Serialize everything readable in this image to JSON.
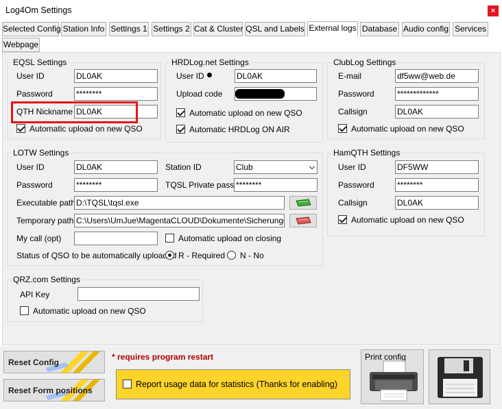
{
  "window": {
    "title": "Log4Om Settings",
    "close_glyph": "×"
  },
  "tabs": [
    {
      "label": "Selected Config"
    },
    {
      "label": "Station Info"
    },
    {
      "label": "Settings 1"
    },
    {
      "label": "Settings 2"
    },
    {
      "label": "Cat & Cluster"
    },
    {
      "label": "QSL and Labels"
    },
    {
      "label": "External logs"
    },
    {
      "label": "Database"
    },
    {
      "label": "Audio config"
    },
    {
      "label": "Services"
    },
    {
      "label": "Webpage"
    }
  ],
  "eqsl": {
    "title": "EQSL Settings",
    "user_id_label": "User ID",
    "user_id": "DL0AK",
    "password_label": "Password",
    "password": "********",
    "qth_label": "QTH Nickname",
    "qth": "DL0AK",
    "auto_label": "Automatic upload on new QSO"
  },
  "hrdlog": {
    "title": "HRDLog.net Settings",
    "user_id_label": "User ID",
    "user_id": "DL0AK",
    "upload_code_label": "Upload code",
    "auto_label": "Automatic upload on new QSO",
    "onair_label": "Automatic HRDLog ON AIR"
  },
  "clublog": {
    "title": "ClubLog Settings",
    "email_label": "E-mail",
    "email": "df5ww@web.de",
    "password_label": "Password",
    "password": "*************",
    "callsign_label": "Callsign",
    "callsign": "DL0AK",
    "auto_label": "Automatic upload on new QSO"
  },
  "lotw": {
    "title": "LOTW Settings",
    "user_id_label": "User ID",
    "user_id": "DL0AK",
    "password_label": "Password",
    "password": "********",
    "station_id_label": "Station ID",
    "station_id": "Club",
    "tqsl_pass_label": "TQSL Private pass",
    "tqsl_pass": "********",
    "exec_label": "Executable path",
    "exec_path": "D:\\TQSL\\tqsl.exe",
    "temp_label": "Temporary path",
    "temp_path": "C:\\Users\\UmJue\\MagentaCLOUD\\Dokumente\\Sicherungen Lc",
    "mycall_label": "My call (opt)",
    "auto_close_label": "Automatic upload on closing",
    "status_label": "Status of QSO to be automatically uploaded",
    "required_label": "R - Required",
    "no_label": "N - No"
  },
  "hamqth": {
    "title": "HamQTH Settings",
    "user_id_label": "User ID",
    "user_id": "DF5WW",
    "password_label": "Password",
    "password": "********",
    "callsign_label": "Callsign",
    "callsign": "DL0AK",
    "auto_label": "Automatic upload on new QSO"
  },
  "qrz": {
    "title": "QRZ.com Settings",
    "api_label": "API Key",
    "auto_label": "Automatic upload on new QSO"
  },
  "bottom": {
    "reset_config": "Reset Config",
    "reset_form": "Reset Form positions",
    "restart_note": "* requires program restart",
    "stats_label": "Report usage data for statistics (Thanks for enabling)",
    "print_config": "Print config"
  },
  "colors": {
    "accent_red": "#e3161c",
    "highlight_yellow": "#ffd42a",
    "panel": "#f0f0f0"
  }
}
